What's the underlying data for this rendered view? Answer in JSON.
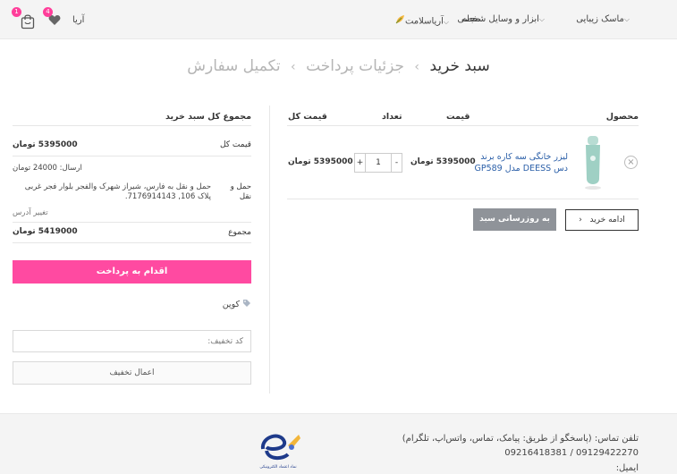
{
  "header": {
    "nav": [
      {
        "label": "ماسک زیبایی",
        "has_caret": true
      },
      {
        "label": "ابزار و وسایل شخصی",
        "has_caret": true
      },
      {
        "label": "مجله",
        "has_caret": false
      },
      {
        "label": "آریاسلامت",
        "has_caret": true
      }
    ],
    "brand": "آریا",
    "wishlist_count": "4",
    "cart_count": "1"
  },
  "breadcrumb": {
    "step1": "سبد خرید",
    "step2": "جزئیات پرداخت",
    "step3": "تکمیل سفارش",
    "separator": "›"
  },
  "cart_table": {
    "headers": {
      "product": "محصول",
      "price": "قیمت",
      "quantity": "تعداد",
      "subtotal": "قیمت کل"
    },
    "rows": [
      {
        "remove": "×",
        "name": "لیزر خانگی سه کاره برند دس DEESS مدل GP589",
        "price": "5395000 تومان",
        "quantity": "1",
        "minus": "-",
        "plus": "+",
        "subtotal": "5395000 تومان"
      }
    ],
    "continue_label": "ادامه خرید",
    "continue_icon": "‹",
    "update_label": "به روزرسانی سبد"
  },
  "totals": {
    "title": "مجموع کل سبد خرید",
    "subtotal_label": "قیمت کل",
    "subtotal_value": "5395000 تومان",
    "shipping_fee": "ارسال: 24000 تومان",
    "shipping_label": "حمل و نقل",
    "shipping_desc": "حمل و نقل به فارس، شیراز شهرک والفجر بلوار فجر غربی پلاک 106, 7176914143.",
    "change_address": "تغییر آدرس",
    "total_label": "مجموع",
    "total_value": "5419000 تومان",
    "checkout_label": "اقدام به پرداخت",
    "coupon_label": "کوپن",
    "coupon_placeholder": "کد تخفیف:",
    "apply_label": "اعمال تخفیف"
  },
  "footer": {
    "phone_title": "تلفن تماس: (پاسخگو از طریق: پیامک، تماس، واتس‌اپ، تلگرام)",
    "phones": "09129422270 / 09216418381",
    "email_label": "ایمیل:",
    "trust_caption": "نماد اعتماد الکترونیکی"
  },
  "colors": {
    "accent": "#ff4aa1",
    "badge": "#ff3e9a",
    "link_blue": "#2b5fa8",
    "update_btn": "#8f9399"
  }
}
